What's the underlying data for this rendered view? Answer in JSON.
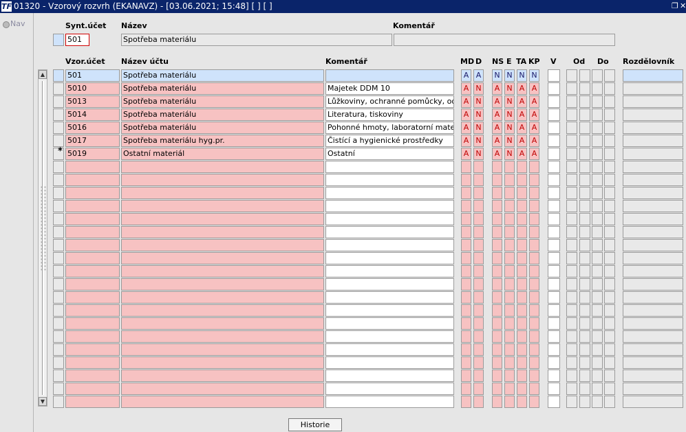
{
  "titlebar": {
    "title": "01320 - Vzorový rozvrh (EKANAVZ) - [03.06.2021; 15:48]  [ ] [ ]",
    "app_icon": "TF",
    "restore_glyph": "❐",
    "close_glyph": "✕"
  },
  "nav": {
    "label": "Nav"
  },
  "header": {
    "synt_label": "Synt.účet",
    "nazev_label": "Název",
    "komentar_label": "Komentář",
    "synt_value": "501",
    "nazev_value": "Spotřeba materiálu",
    "komentar_value": ""
  },
  "columns": {
    "vzor_ucet": "Vzor.účet",
    "nazev_uctu": "Název účtu",
    "komentar": "Komentář",
    "md": "MD",
    "d": "D",
    "ns": "NS",
    "e": "E",
    "ta": "TA",
    "kp": "KP",
    "v": "V",
    "od": "Od",
    "do": "Do",
    "rozdelovnik": "Rozdělovník"
  },
  "rows": [
    {
      "ucet": "501",
      "nazev": "Spotřeba materiálu",
      "komentar": "",
      "md": "A",
      "d": "A",
      "ns": "N",
      "e": "N",
      "ta": "N",
      "kp": "N",
      "marker": "",
      "selected": true
    },
    {
      "ucet": "5010",
      "nazev": "Spotřeba materiálu",
      "komentar": "Majetek DDM 10",
      "md": "A",
      "d": "N",
      "ns": "A",
      "e": "N",
      "ta": "A",
      "kp": "A",
      "marker": ""
    },
    {
      "ucet": "5013",
      "nazev": "Spotřeba materiálu",
      "komentar": "Lůžkoviny, ochranné pomůcky, oděvy",
      "md": "A",
      "d": "N",
      "ns": "A",
      "e": "N",
      "ta": "A",
      "kp": "A",
      "marker": ""
    },
    {
      "ucet": "5014",
      "nazev": "Spotřeba materiálu",
      "komentar": "Literatura, tiskoviny",
      "md": "A",
      "d": "N",
      "ns": "A",
      "e": "N",
      "ta": "A",
      "kp": "A",
      "marker": ""
    },
    {
      "ucet": "5016",
      "nazev": "Spotřeba materiálu",
      "komentar": "Pohonné hmoty, laboratorní materiály",
      "md": "A",
      "d": "N",
      "ns": "A",
      "e": "N",
      "ta": "A",
      "kp": "A",
      "marker": ""
    },
    {
      "ucet": "5017",
      "nazev": "Spotřeba materiálu hyg.pr.",
      "komentar": "Čistící a hygienické prostředky",
      "md": "A",
      "d": "N",
      "ns": "A",
      "e": "N",
      "ta": "A",
      "kp": "A",
      "marker": ""
    },
    {
      "ucet": "5019",
      "nazev": "Ostatní materiál",
      "komentar": "Ostatní",
      "md": "A",
      "d": "N",
      "ns": "A",
      "e": "N",
      "ta": "A",
      "kp": "A",
      "marker": "*"
    }
  ],
  "empty_rows": 19,
  "scroll": {
    "up": "▲",
    "down": "▼"
  },
  "buttons": {
    "historie": "Historie"
  },
  "colors": {
    "titlebar": "#0a246a",
    "selected_row": "#cfe3fb",
    "pink_cell": "#f7c2c2",
    "focus_border": "#d00000"
  }
}
